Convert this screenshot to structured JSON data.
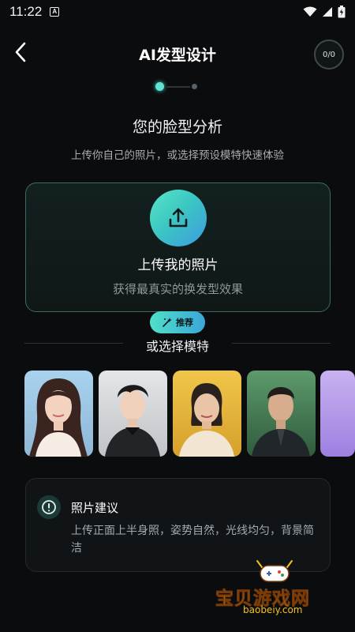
{
  "status_bar": {
    "time": "11:22",
    "notification_badge": "A"
  },
  "header": {
    "title": "AI发型设计",
    "counter": "0/0"
  },
  "stepper": {
    "current_step": 1,
    "total_steps": 2
  },
  "section": {
    "title": "您的脸型分析",
    "subtitle": "上传你自己的照片，或选择预设模特快速体验"
  },
  "upload": {
    "title": "上传我的照片",
    "subtitle": "获得最真实的换发型效果",
    "icon": "upload-icon"
  },
  "recommend_badge": "推荐",
  "or_label": "或选择模特",
  "models": [
    {
      "name": "model-young-woman",
      "bg": "#9cc8e6"
    },
    {
      "name": "model-young-man",
      "bg": "#cfd2d6"
    },
    {
      "name": "model-older-woman",
      "bg": "#e3b340"
    },
    {
      "name": "model-older-man",
      "bg": "#4c8a5e"
    },
    {
      "name": "model-partial",
      "bg": "#b79be8"
    }
  ],
  "tips": {
    "title": "照片建议",
    "body": "上传正面上半身照，姿势自然，光线均匀，背景简洁"
  },
  "watermark": {
    "name": "宝贝游戏网",
    "url": "baobeiy.com"
  },
  "colors": {
    "accent": "#4fe0c8",
    "accent2": "#3b9be0",
    "background": "#0b0c0e",
    "watermark": "#f6c21a"
  }
}
